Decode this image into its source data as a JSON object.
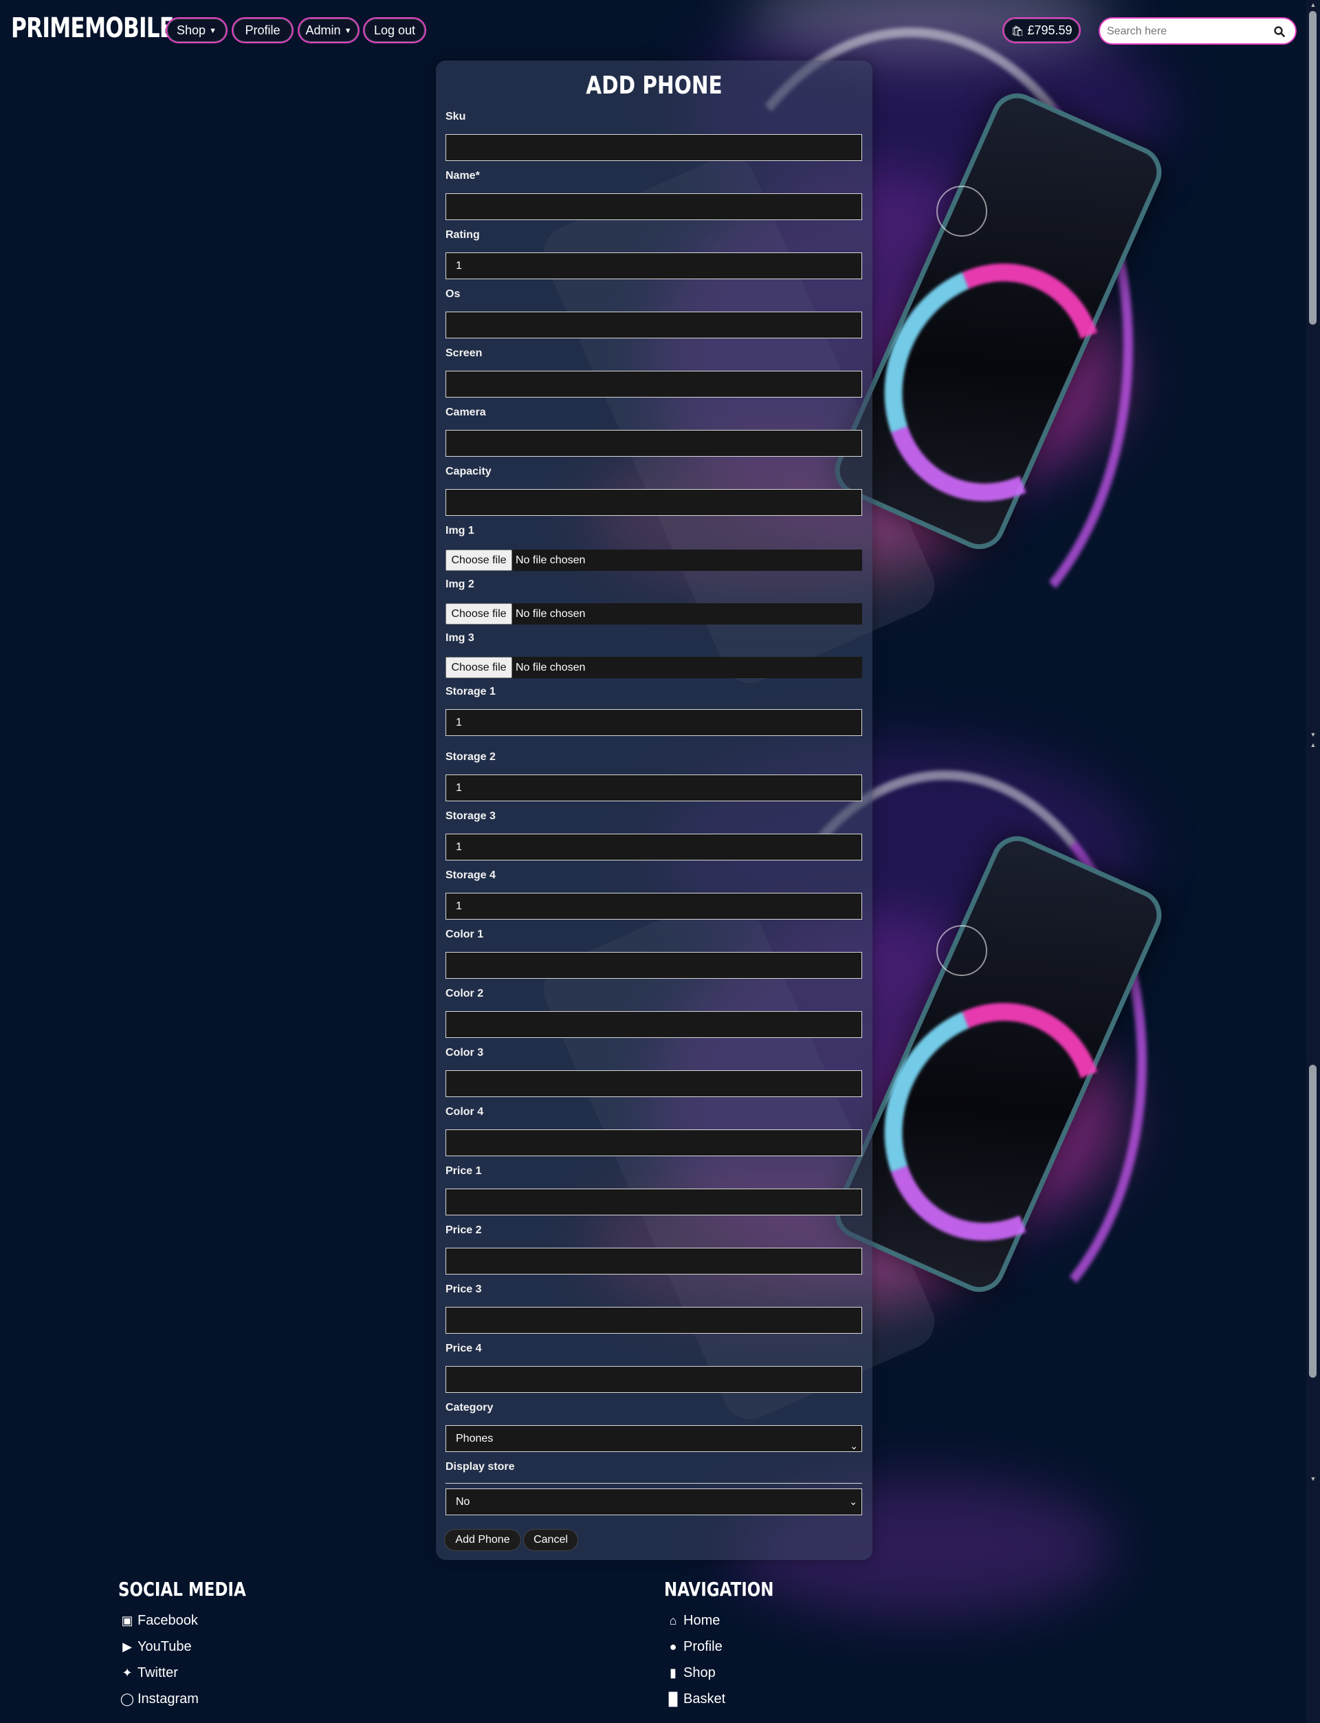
{
  "brand": "PRIMEMOBILE",
  "nav": {
    "shop": "Shop",
    "profile": "Profile",
    "admin": "Admin",
    "logout": "Log out",
    "basket_total": "£795.59",
    "search_placeholder": "Search here"
  },
  "form": {
    "title": "ADD PHONE",
    "fields": [
      {
        "label": "Sku",
        "value": ""
      },
      {
        "label": "Name*",
        "value": ""
      },
      {
        "label": "Rating",
        "value": "1"
      },
      {
        "label": "Os",
        "value": ""
      },
      {
        "label": "Screen",
        "value": ""
      },
      {
        "label": "Camera",
        "value": ""
      },
      {
        "label": "Capacity",
        "value": ""
      }
    ],
    "files": [
      {
        "label": "Img 1",
        "button": "Choose file",
        "status": "No file chosen"
      },
      {
        "label": "Img 2",
        "button": "Choose file",
        "status": "No file chosen"
      },
      {
        "label": "Img 3",
        "button": "Choose file",
        "status": "No file chosen"
      }
    ],
    "fields2": [
      {
        "label": "Storage 1",
        "value": "1"
      },
      {
        "label": "Storage 2",
        "value": "1"
      },
      {
        "label": "Storage 3",
        "value": "1"
      },
      {
        "label": "Storage 4",
        "value": "1"
      },
      {
        "label": "Color 1",
        "value": ""
      },
      {
        "label": "Color 2",
        "value": ""
      },
      {
        "label": "Color 3",
        "value": ""
      },
      {
        "label": "Color 4",
        "value": ""
      },
      {
        "label": "Price 1",
        "value": ""
      },
      {
        "label": "Price 2",
        "value": ""
      },
      {
        "label": "Price 3",
        "value": ""
      },
      {
        "label": "Price 4",
        "value": ""
      }
    ],
    "category": {
      "label": "Category",
      "value": "Phones"
    },
    "display_store": {
      "label": "Display store",
      "value": "No"
    },
    "submit": "Add Phone",
    "cancel": "Cancel"
  },
  "footer": {
    "social_title": "SOCIAL MEDIA",
    "social": [
      "Facebook",
      "YouTube",
      "Twitter",
      "Instagram"
    ],
    "nav_title": "NAVIGATION",
    "nav": [
      "Home",
      "Profile",
      "Shop",
      "Basket"
    ]
  },
  "colors": {
    "background": "#04122a",
    "accent_border": "#e23fc0",
    "input_bg": "#181818"
  }
}
